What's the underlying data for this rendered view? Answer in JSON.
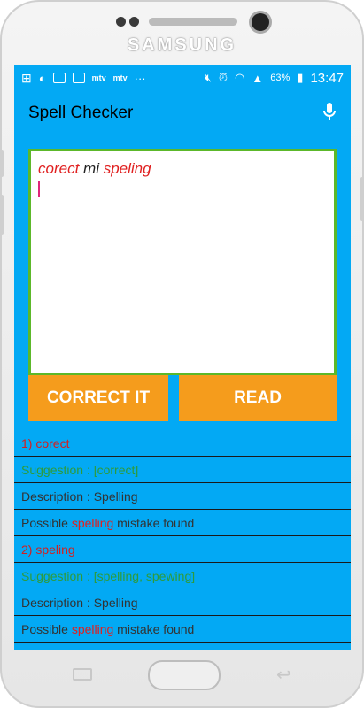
{
  "device": {
    "brand": "SAMSUNG"
  },
  "status_bar": {
    "battery": "63%",
    "time": "13:47",
    "icons": [
      "add-icon",
      "moon-icon",
      "image-icon",
      "mail-icon",
      "mtv-icon",
      "mtv-icon",
      "dots-icon",
      "mute-icon",
      "alarm-icon",
      "wifi-icon",
      "signal-icon",
      "battery-icon"
    ]
  },
  "app": {
    "title": "Spell Checker"
  },
  "editor": {
    "words": [
      {
        "text": "corect",
        "error": true
      },
      {
        "text": "mi",
        "error": false
      },
      {
        "text": "speling",
        "error": true
      }
    ]
  },
  "buttons": {
    "correct_label": "CORRECT IT",
    "read_label": "READ"
  },
  "results": [
    {
      "heading": "1) corect",
      "suggestion": "Suggestion : [correct]",
      "description": "Description : Spelling",
      "possible_prefix": "Possible ",
      "possible_word": "spelling",
      "possible_suffix": " mistake found"
    },
    {
      "heading": "2) speling",
      "suggestion": "Suggestion : [spelling, spewing]",
      "description": "Description : Spelling",
      "possible_prefix": "Possible ",
      "possible_word": "spelling",
      "possible_suffix": " mistake found"
    }
  ],
  "colors": {
    "screen_bg": "#03a9f4",
    "button": "#f59c1c",
    "editor_border": "#5cb82a",
    "error": "#e02020",
    "suggestion": "#2e9b3a"
  }
}
